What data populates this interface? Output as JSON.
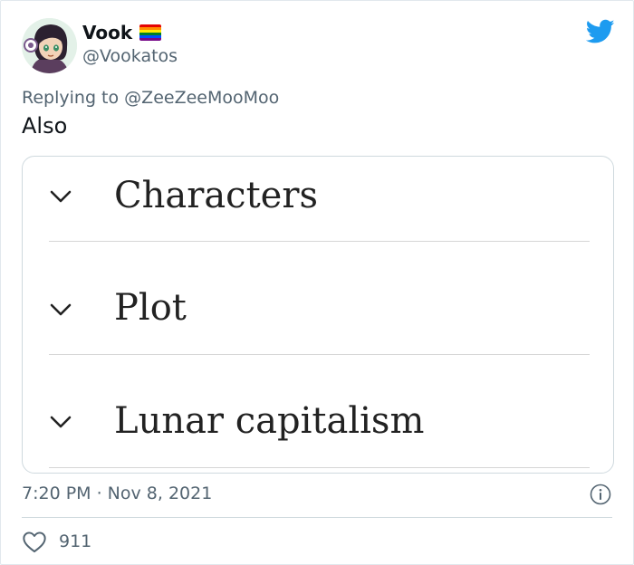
{
  "author": {
    "display_name": "Vook",
    "handle": "@Vookatos",
    "avatar_icon": "avatar-portrait-icon",
    "flag_icon": "rainbow-pride-flag-icon",
    "flag_colors": [
      "#e40303",
      "#ff8c00",
      "#ffed00",
      "#008026",
      "#004dff",
      "#750787"
    ]
  },
  "brand": {
    "icon": "twitter-bird-icon",
    "color": "#1d9bf0"
  },
  "reply": {
    "prefix": "Replying to",
    "mention": "@ZeeZeeMooMoo"
  },
  "tweet": {
    "text": "Also",
    "timestamp": "7:20 PM · Nov 8, 2021"
  },
  "embedded_image": {
    "accordion_items": [
      {
        "label": "Characters",
        "icon": "chevron-down-icon"
      },
      {
        "label": "Plot",
        "icon": "chevron-down-icon"
      },
      {
        "label": "Lunar capitalism",
        "icon": "chevron-down-icon"
      }
    ]
  },
  "engagement": {
    "likes": "911",
    "like_icon": "heart-icon",
    "info_icon": "info-icon"
  }
}
